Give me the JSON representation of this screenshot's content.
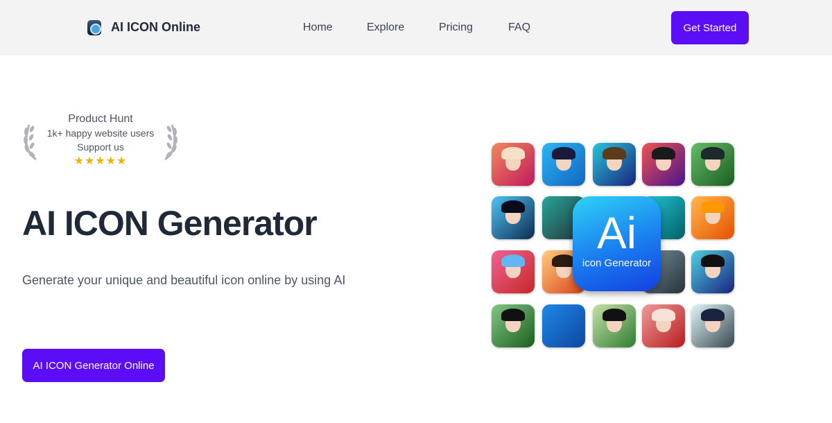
{
  "nav": {
    "brand": "AI ICON Online",
    "links": [
      "Home",
      "Explore",
      "Pricing",
      "FAQ"
    ],
    "cta": "Get Started"
  },
  "badge": {
    "title": "Product Hunt",
    "users": "1k+ happy website users",
    "support": "Support us",
    "stars": 5,
    "stars_text": "★★★★★"
  },
  "hero": {
    "title": "AI ICON Generator",
    "subtitle": "Generate your unique and beautiful icon online by using AI",
    "button": "AI ICON Generator Online"
  },
  "showcase": {
    "logo_big": "Ai",
    "logo_small": "icon Generator"
  },
  "colors": {
    "accent": "#5b0ef5",
    "nav_bg": "#f3f3f3",
    "star": "#eab308"
  }
}
